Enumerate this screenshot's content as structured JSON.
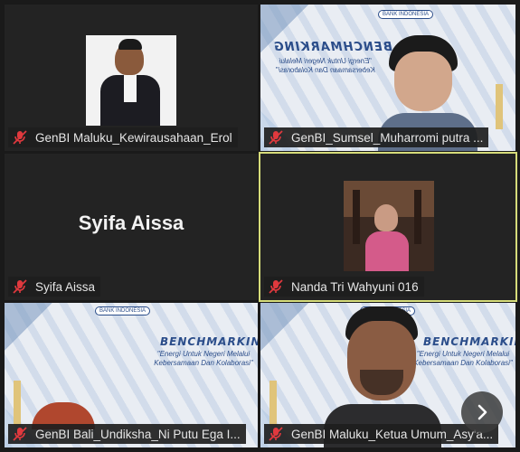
{
  "participants": [
    {
      "name": "GenBI Maluku_Kewirausahaan_Erol",
      "muted": true
    },
    {
      "name": "GenBI_Sumsel_Muharromi putra ...",
      "muted": true
    },
    {
      "name": "Syifa Aissa",
      "muted": true,
      "avatar_text": "Syifa Aissa"
    },
    {
      "name": "Nanda Tri Wahyuni 016",
      "muted": true,
      "active_speaker": true
    },
    {
      "name": "GenBI Bali_Undiksha_Ni Putu Ega I...",
      "muted": true
    },
    {
      "name": "GenBI Maluku_Ketua Umum_Asy'a...",
      "muted": true
    }
  ],
  "banner": {
    "title": "BENCHMARKING",
    "subtitle_line1": "\"Energi Untuk Negeri Melalui",
    "subtitle_line2": "Kebersamaan Dan Kolaborasi\"",
    "logo_text": "BANK INDONESIA"
  },
  "colors": {
    "background": "#1a1a1a",
    "tile": "#232323",
    "active_border": "#d6dc7a",
    "muted_icon": "#e0393e"
  },
  "icons": {
    "mute": "mic-off-icon",
    "next": "chevron-right-icon"
  }
}
